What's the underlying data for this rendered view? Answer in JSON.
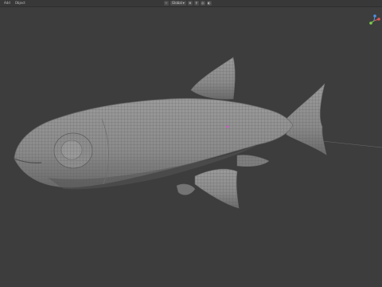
{
  "app": {
    "name": "Blender 3D viewport"
  },
  "header": {
    "menu": [
      "Add",
      "Object"
    ],
    "shading_dropdown": "Global",
    "tools": [
      "pivot-icon",
      "snap-icon",
      "proportional-icon",
      "overlay-icon"
    ]
  },
  "viewport": {
    "object": "fish mesh (sculpt/retopo wireframe)",
    "colors": {
      "background": "#3d3d3d",
      "mesh": "#8a8a8a",
      "wire": "#5a5a5a",
      "origin": "#d05ac8",
      "axis_x": "#e05555",
      "axis_y": "#7fd04a",
      "axis_z": "#4f8fe6"
    }
  }
}
